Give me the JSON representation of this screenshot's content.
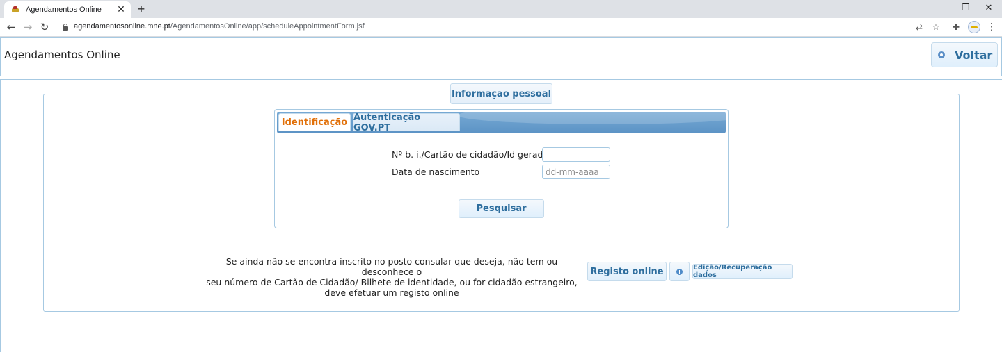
{
  "browser": {
    "tab_title": "Agendamentos Online",
    "url_host": "agendamentosonline.mne.pt",
    "url_path": "/AgendamentosOnline/app/scheduleAppointmentForm.jsf"
  },
  "header": {
    "title": "Agendamentos Online",
    "back_button": "Voltar"
  },
  "section": {
    "legend": "Informação pessoal",
    "tabs": [
      {
        "label": "Identificação",
        "active": true
      },
      {
        "label": "Autenticação GOV.PT",
        "active": false
      }
    ],
    "fields": {
      "id_label": "Nº b. i./Cartão de cidadão/Id gerado",
      "id_value": "",
      "dob_label": "Data de nascimento",
      "dob_placeholder": "dd-mm-aaaa"
    },
    "search_button": "Pesquisar"
  },
  "registration": {
    "lines": [
      "Se ainda não se encontra inscrito no posto consular que deseja, não tem ou desconhece o",
      "seu número de Cartão de Cidadão/ Bilhete de identidade, ou for cidadão estrangeiro,",
      "deve efetuar um registo online"
    ],
    "register_button": "Registo online",
    "recover_button": "Edição/Recuperação dados"
  },
  "icons": {
    "tab_favicon": "crown-favicon-icon",
    "lock": "lock-icon",
    "back_arrow": "arrow-left-icon",
    "forward_arrow": "arrow-right-icon",
    "reload": "reload-icon",
    "voltar": "circle-arrow-icon",
    "info": "info-icon"
  }
}
